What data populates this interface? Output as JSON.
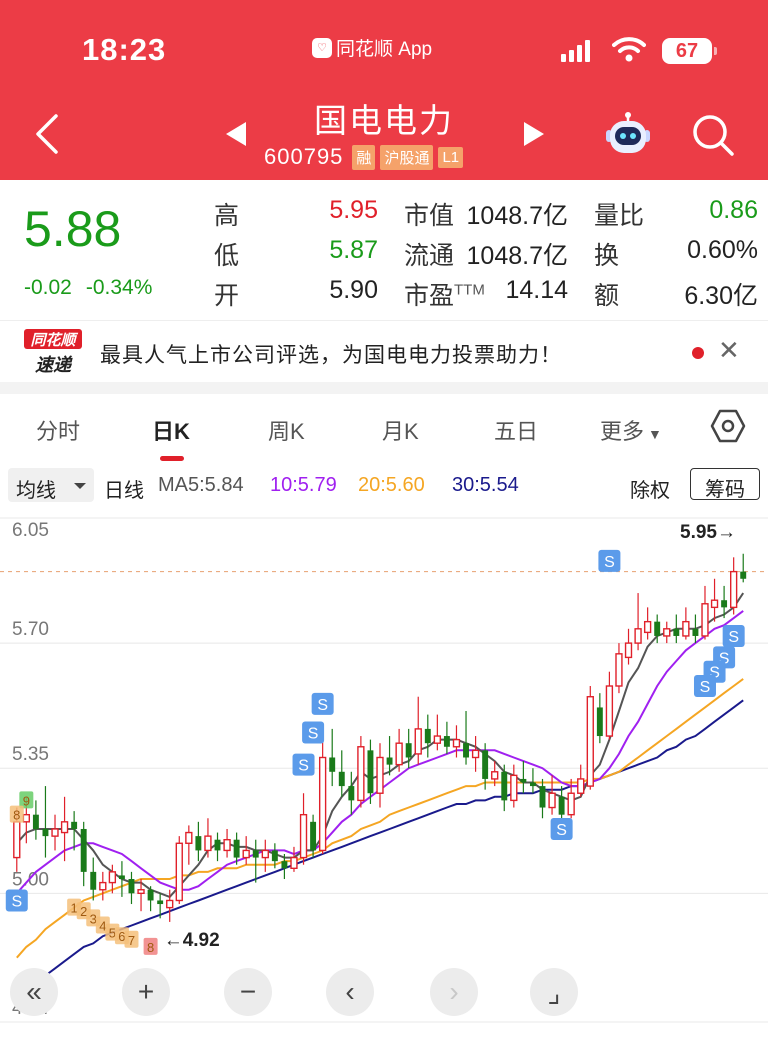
{
  "status_bar": {
    "time": "18:23",
    "app_source": "同花顺 App",
    "battery": "67"
  },
  "header": {
    "stock_name": "国电电力",
    "stock_code": "600795",
    "tags": [
      "融",
      "沪股通",
      "L1"
    ]
  },
  "quote": {
    "price": "5.88",
    "change": "-0.02",
    "change_pct": "-0.34%",
    "rows": [
      {
        "l1": "高",
        "v1": "5.95",
        "l2": "市值",
        "v2": "1048.7亿",
        "l3": "量比",
        "v3": "0.86"
      },
      {
        "l1": "低",
        "v1": "5.87",
        "l2": "流通",
        "v2": "1048.7亿",
        "l3": "换",
        "v3": "0.60%"
      },
      {
        "l1": "开",
        "v1": "5.90",
        "l2": "市盈",
        "l2_sup": "TTM",
        "v2": "14.14",
        "l3": "额",
        "v3": "6.30亿"
      }
    ],
    "colors": {
      "up": "#e0202a",
      "down": "#1a9b1a"
    }
  },
  "banner": {
    "logo_top": "同花顺",
    "logo_bottom": "速递",
    "text": "最具人气上市公司评选，为国电电力投票助力！"
  },
  "tabs": [
    {
      "label": "分时",
      "active": false
    },
    {
      "label": "日K",
      "active": true
    },
    {
      "label": "周K",
      "active": false
    },
    {
      "label": "月K",
      "active": false
    },
    {
      "label": "五日",
      "active": false
    },
    {
      "label": "更多",
      "active": false
    }
  ],
  "indicators": {
    "selector": "均线",
    "period": "日线",
    "ma5": "MA5:5.84",
    "ma10": "10:5.79",
    "ma20": "20:5.60",
    "ma30": "30:5.54",
    "ex_rights": "除权",
    "chips_button": "筹码",
    "colors": {
      "ma5": "#555555",
      "ma10": "#a020f0",
      "ma20": "#f5a623",
      "ma30": "#1a1a8c"
    }
  },
  "chart_data": {
    "type": "candlestick",
    "y_ticks": [
      "6.05",
      "5.70",
      "5.35",
      "5.00",
      "4.64"
    ],
    "ylim": [
      4.64,
      6.05
    ],
    "high_marker": "5.95→",
    "low_marker": "←4.92",
    "signal_label": "S",
    "sequence_labels": [
      "9",
      "8",
      "1",
      "2",
      "3",
      "4",
      "5",
      "6",
      "7",
      "8"
    ],
    "dashed_level": 5.9,
    "candles": [
      [
        5.1,
        5.2,
        5.24,
        5.06
      ],
      [
        5.2,
        5.22,
        5.27,
        5.14
      ],
      [
        5.22,
        5.18,
        5.26,
        5.15
      ],
      [
        5.18,
        5.16,
        5.3,
        5.1
      ],
      [
        5.16,
        5.18,
        5.22,
        5.12
      ],
      [
        5.17,
        5.2,
        5.27,
        5.09
      ],
      [
        5.2,
        5.18,
        5.23,
        5.12
      ],
      [
        5.18,
        5.06,
        5.2,
        5.02
      ],
      [
        5.06,
        5.01,
        5.1,
        4.98
      ],
      [
        5.01,
        5.03,
        5.06,
        4.98
      ],
      [
        5.03,
        5.06,
        5.08,
        5.0
      ],
      [
        5.05,
        5.04,
        5.09,
        4.99
      ],
      [
        5.04,
        5.0,
        5.06,
        4.97
      ],
      [
        5.0,
        5.01,
        5.04,
        4.95
      ],
      [
        5.01,
        4.98,
        5.02,
        4.95
      ],
      [
        4.98,
        4.97,
        5.0,
        4.93
      ],
      [
        4.96,
        4.98,
        5.01,
        4.92
      ],
      [
        4.98,
        5.14,
        5.16,
        4.97
      ],
      [
        5.14,
        5.17,
        5.19,
        5.08
      ],
      [
        5.16,
        5.12,
        5.2,
        5.09
      ],
      [
        5.12,
        5.16,
        5.21,
        5.1
      ],
      [
        5.15,
        5.12,
        5.17,
        5.09
      ],
      [
        5.12,
        5.15,
        5.18,
        5.1
      ],
      [
        5.15,
        5.1,
        5.17,
        5.08
      ],
      [
        5.1,
        5.12,
        5.16,
        5.08
      ],
      [
        5.12,
        5.1,
        5.15,
        5.03
      ],
      [
        5.1,
        5.12,
        5.15,
        5.06
      ],
      [
        5.12,
        5.09,
        5.14,
        5.07
      ],
      [
        5.09,
        5.07,
        5.11,
        5.04
      ],
      [
        5.07,
        5.1,
        5.13,
        5.06
      ],
      [
        5.1,
        5.22,
        5.28,
        5.08
      ],
      [
        5.2,
        5.12,
        5.22,
        5.1
      ],
      [
        5.12,
        5.38,
        5.44,
        5.11
      ],
      [
        5.38,
        5.34,
        5.46,
        5.3
      ],
      [
        5.34,
        5.3,
        5.4,
        5.27
      ],
      [
        5.3,
        5.26,
        5.34,
        5.22
      ],
      [
        5.26,
        5.41,
        5.44,
        5.24
      ],
      [
        5.4,
        5.28,
        5.43,
        5.25
      ],
      [
        5.28,
        5.38,
        5.42,
        5.24
      ],
      [
        5.38,
        5.36,
        5.44,
        5.33
      ],
      [
        5.36,
        5.42,
        5.46,
        5.34
      ],
      [
        5.42,
        5.38,
        5.46,
        5.35
      ],
      [
        5.39,
        5.46,
        5.55,
        5.36
      ],
      [
        5.46,
        5.42,
        5.5,
        5.38
      ],
      [
        5.42,
        5.44,
        5.5,
        5.4
      ],
      [
        5.44,
        5.41,
        5.48,
        5.39
      ],
      [
        5.41,
        5.43,
        5.47,
        5.38
      ],
      [
        5.42,
        5.38,
        5.51,
        5.36
      ],
      [
        5.38,
        5.4,
        5.44,
        5.34
      ],
      [
        5.4,
        5.32,
        5.42,
        5.29
      ],
      [
        5.32,
        5.34,
        5.37,
        5.3
      ],
      [
        5.34,
        5.26,
        5.36,
        5.23
      ],
      [
        5.26,
        5.33,
        5.36,
        5.24
      ],
      [
        5.32,
        5.31,
        5.37,
        5.28
      ],
      [
        5.31,
        5.3,
        5.35,
        5.28
      ],
      [
        5.3,
        5.24,
        5.32,
        5.21
      ],
      [
        5.24,
        5.28,
        5.33,
        5.22
      ],
      [
        5.27,
        5.22,
        5.3,
        5.2
      ],
      [
        5.22,
        5.28,
        5.32,
        5.21
      ],
      [
        5.28,
        5.32,
        5.36,
        5.27
      ],
      [
        5.3,
        5.55,
        5.58,
        5.29
      ],
      [
        5.52,
        5.44,
        5.56,
        5.42
      ],
      [
        5.44,
        5.58,
        5.62,
        5.43
      ],
      [
        5.58,
        5.67,
        5.7,
        5.56
      ],
      [
        5.66,
        5.7,
        5.74,
        5.64
      ],
      [
        5.7,
        5.74,
        5.84,
        5.68
      ],
      [
        5.73,
        5.76,
        5.8,
        5.71
      ],
      [
        5.76,
        5.72,
        5.78,
        5.7
      ],
      [
        5.72,
        5.74,
        5.76,
        5.7
      ],
      [
        5.74,
        5.72,
        5.78,
        5.7
      ],
      [
        5.72,
        5.76,
        5.8,
        5.71
      ],
      [
        5.74,
        5.72,
        5.78,
        5.7
      ],
      [
        5.72,
        5.81,
        5.86,
        5.71
      ],
      [
        5.8,
        5.82,
        5.88,
        5.76
      ],
      [
        5.82,
        5.8,
        5.86,
        5.77
      ],
      [
        5.8,
        5.9,
        5.94,
        5.78
      ],
      [
        5.9,
        5.88,
        5.95,
        5.87
      ]
    ],
    "ma5": [
      5.14,
      5.17,
      5.18,
      5.18,
      5.18,
      5.18,
      5.18,
      5.15,
      5.12,
      5.08,
      5.06,
      5.04,
      5.03,
      5.03,
      5.01,
      5.0,
      4.99,
      5.02,
      5.05,
      5.08,
      5.12,
      5.14,
      5.14,
      5.13,
      5.13,
      5.12,
      5.12,
      5.11,
      5.1,
      5.1,
      5.12,
      5.12,
      5.16,
      5.23,
      5.27,
      5.3,
      5.34,
      5.32,
      5.33,
      5.34,
      5.36,
      5.37,
      5.4,
      5.41,
      5.43,
      5.43,
      5.43,
      5.42,
      5.41,
      5.39,
      5.37,
      5.34,
      5.33,
      5.31,
      5.31,
      5.29,
      5.28,
      5.27,
      5.26,
      5.27,
      5.33,
      5.36,
      5.43,
      5.51,
      5.59,
      5.63,
      5.69,
      5.72,
      5.73,
      5.74,
      5.74,
      5.74,
      5.75,
      5.77,
      5.78,
      5.8,
      5.84
    ],
    "ma10": [
      5.0,
      5.03,
      5.06,
      5.08,
      5.1,
      5.12,
      5.13,
      5.14,
      5.14,
      5.13,
      5.12,
      5.11,
      5.09,
      5.07,
      5.05,
      5.03,
      5.02,
      5.01,
      5.01,
      5.02,
      5.04,
      5.06,
      5.08,
      5.09,
      5.1,
      5.11,
      5.12,
      5.12,
      5.12,
      5.11,
      5.12,
      5.12,
      5.14,
      5.17,
      5.2,
      5.22,
      5.25,
      5.27,
      5.29,
      5.31,
      5.33,
      5.35,
      5.36,
      5.37,
      5.38,
      5.39,
      5.4,
      5.4,
      5.4,
      5.4,
      5.4,
      5.39,
      5.38,
      5.37,
      5.36,
      5.35,
      5.33,
      5.31,
      5.3,
      5.3,
      5.31,
      5.32,
      5.35,
      5.39,
      5.44,
      5.48,
      5.53,
      5.58,
      5.62,
      5.65,
      5.68,
      5.7,
      5.72,
      5.74,
      5.75,
      5.77,
      5.79
    ],
    "ma20": [
      4.82,
      4.85,
      4.87,
      4.9,
      4.92,
      4.94,
      4.96,
      4.98,
      4.99,
      5.0,
      5.01,
      5.02,
      5.03,
      5.04,
      5.04,
      5.04,
      5.04,
      5.05,
      5.05,
      5.06,
      5.06,
      5.07,
      5.07,
      5.07,
      5.08,
      5.08,
      5.08,
      5.08,
      5.09,
      5.09,
      5.1,
      5.11,
      5.12,
      5.14,
      5.15,
      5.16,
      5.18,
      5.19,
      5.2,
      5.22,
      5.23,
      5.24,
      5.25,
      5.26,
      5.27,
      5.28,
      5.29,
      5.3,
      5.3,
      5.31,
      5.31,
      5.31,
      5.31,
      5.31,
      5.31,
      5.31,
      5.31,
      5.31,
      5.31,
      5.31,
      5.32,
      5.32,
      5.33,
      5.34,
      5.36,
      5.38,
      5.4,
      5.42,
      5.44,
      5.46,
      5.48,
      5.5,
      5.52,
      5.54,
      5.56,
      5.58,
      5.6
    ],
    "ma30": [
      4.71,
      4.73,
      4.75,
      4.77,
      4.79,
      4.81,
      4.83,
      4.85,
      4.86,
      4.88,
      4.89,
      4.9,
      4.91,
      4.92,
      4.93,
      4.94,
      4.95,
      4.96,
      4.97,
      4.98,
      4.99,
      5.0,
      5.01,
      5.02,
      5.03,
      5.04,
      5.05,
      5.06,
      5.07,
      5.08,
      5.09,
      5.1,
      5.11,
      5.12,
      5.13,
      5.14,
      5.15,
      5.16,
      5.17,
      5.18,
      5.19,
      5.2,
      5.21,
      5.22,
      5.23,
      5.24,
      5.25,
      5.25,
      5.26,
      5.26,
      5.27,
      5.27,
      5.28,
      5.28,
      5.28,
      5.29,
      5.29,
      5.29,
      5.3,
      5.3,
      5.31,
      5.32,
      5.33,
      5.34,
      5.35,
      5.36,
      5.37,
      5.38,
      5.4,
      5.41,
      5.43,
      5.44,
      5.46,
      5.48,
      5.5,
      5.52,
      5.54
    ]
  },
  "controls": [
    "«",
    "+",
    "−",
    "‹",
    "›",
    "⌟"
  ]
}
